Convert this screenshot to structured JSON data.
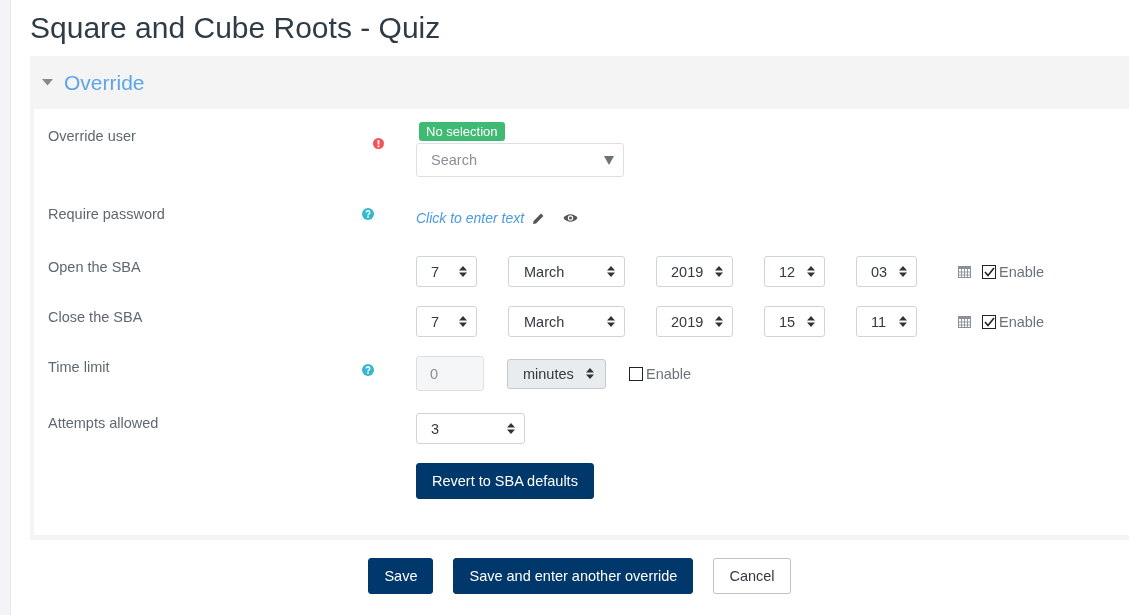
{
  "title": "Square and Cube Roots - Quiz",
  "section": {
    "title": "Override",
    "expanded": true
  },
  "fields": [
    {
      "kind": "autocomplete",
      "label": "Override user",
      "required": true,
      "badge": "No selection",
      "placeholder": "Search"
    },
    {
      "kind": "inline-text",
      "label": "Require password",
      "help": true,
      "value": "Click to enter text"
    },
    {
      "kind": "datetime",
      "label": "Open the SBA",
      "day": "7",
      "month": "March",
      "year": "2019",
      "hour": "12",
      "minute": "03",
      "enable": {
        "label": "Enable",
        "checked": true
      }
    },
    {
      "kind": "datetime",
      "label": "Close the SBA",
      "day": "7",
      "month": "March",
      "year": "2019",
      "hour": "15",
      "minute": "11",
      "enable": {
        "label": "Enable",
        "checked": true
      }
    },
    {
      "kind": "duration",
      "label": "Time limit",
      "help": true,
      "value": "0",
      "unit": "minutes",
      "disabled": true,
      "enable": {
        "label": "Enable",
        "checked": false
      }
    },
    {
      "kind": "select",
      "label": "Attempts allowed",
      "value": "3"
    },
    {
      "kind": "button",
      "label": "Revert to SBA defaults"
    }
  ],
  "buttons": [
    {
      "label": "Save",
      "kind": "primary"
    },
    {
      "label": "Save and enter another override",
      "kind": "primary"
    },
    {
      "label": "Cancel",
      "kind": "secondary"
    }
  ]
}
